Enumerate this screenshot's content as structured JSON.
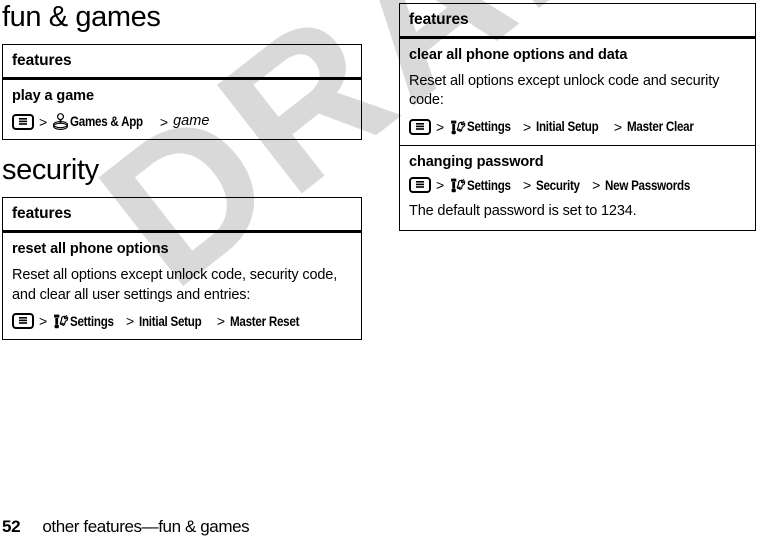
{
  "watermark": {
    "text": "DRAFT"
  },
  "left_column": {
    "heading": "fun & games",
    "table": {
      "header": "features",
      "rows": [
        {
          "title": "play a game",
          "body": "",
          "path": {
            "menu_icon": "menu-icon",
            "sep1": ">",
            "app_icon": "joystick-icon",
            "item1": "Games & App",
            "sep2": ">",
            "item2": "game"
          }
        }
      ]
    },
    "heading2": "security",
    "table2": {
      "header": "features",
      "rows": [
        {
          "title": "reset all phone options",
          "body": "Reset all options except unlock code, security code, and clear all user settings and entries:",
          "path": {
            "menu_icon": "menu-icon",
            "sep1": ">",
            "app_icon": "settings-tools-icon",
            "item1": "Settings",
            "sep2": ">",
            "item2": "Initial Setup",
            "sep3": ">",
            "item3": "Master Reset"
          }
        }
      ]
    }
  },
  "right_column": {
    "table": {
      "header": "features",
      "rows": [
        {
          "title": "clear all phone options and data",
          "body": "Reset all options except unlock code and security code:",
          "path": {
            "menu_icon": "menu-icon",
            "sep1": ">",
            "app_icon": "settings-tools-icon",
            "item1": "Settings",
            "sep2": ">",
            "item2": "Initial Setup",
            "sep3": ">",
            "item3": "Master Clear"
          }
        },
        {
          "title": "changing password",
          "body": "The default password is set to 1234.",
          "path": {
            "menu_icon": "menu-icon",
            "sep1": ">",
            "app_icon": "settings-tools-icon",
            "item1": "Settings",
            "sep2": ">",
            "item2": "Security",
            "sep3": ">",
            "item3": "New Passwords"
          }
        }
      ]
    }
  },
  "footer": {
    "page_number": "52",
    "breadcrumb": "other features—fun & games"
  },
  "colors": {
    "text": "#000000",
    "background": "#ffffff",
    "watermark": "#d9d9d9",
    "rule": "#000000"
  }
}
